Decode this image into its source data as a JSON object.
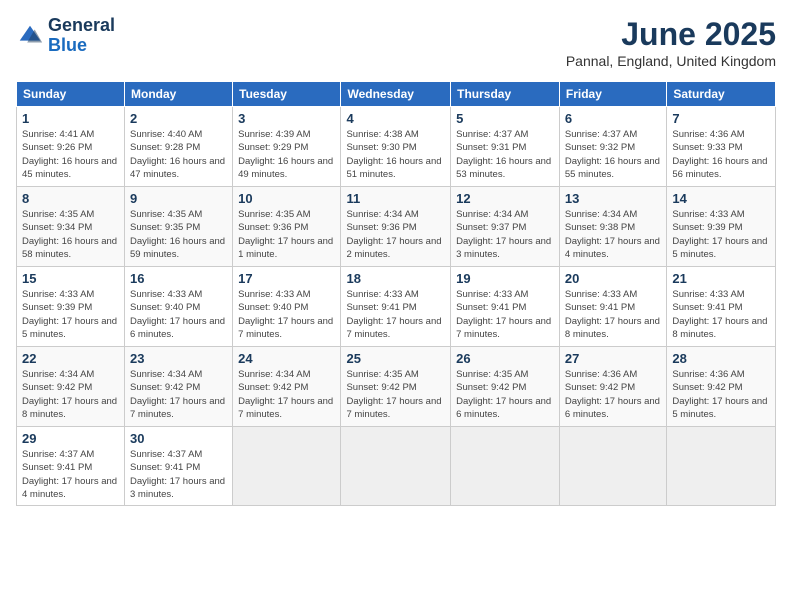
{
  "logo": {
    "line1": "General",
    "line2": "Blue"
  },
  "title": "June 2025",
  "subtitle": "Pannal, England, United Kingdom",
  "days_header": [
    "Sunday",
    "Monday",
    "Tuesday",
    "Wednesday",
    "Thursday",
    "Friday",
    "Saturday"
  ],
  "weeks": [
    [
      {
        "day": "1",
        "info": "Sunrise: 4:41 AM\nSunset: 9:26 PM\nDaylight: 16 hours and 45 minutes."
      },
      {
        "day": "2",
        "info": "Sunrise: 4:40 AM\nSunset: 9:28 PM\nDaylight: 16 hours and 47 minutes."
      },
      {
        "day": "3",
        "info": "Sunrise: 4:39 AM\nSunset: 9:29 PM\nDaylight: 16 hours and 49 minutes."
      },
      {
        "day": "4",
        "info": "Sunrise: 4:38 AM\nSunset: 9:30 PM\nDaylight: 16 hours and 51 minutes."
      },
      {
        "day": "5",
        "info": "Sunrise: 4:37 AM\nSunset: 9:31 PM\nDaylight: 16 hours and 53 minutes."
      },
      {
        "day": "6",
        "info": "Sunrise: 4:37 AM\nSunset: 9:32 PM\nDaylight: 16 hours and 55 minutes."
      },
      {
        "day": "7",
        "info": "Sunrise: 4:36 AM\nSunset: 9:33 PM\nDaylight: 16 hours and 56 minutes."
      }
    ],
    [
      {
        "day": "8",
        "info": "Sunrise: 4:35 AM\nSunset: 9:34 PM\nDaylight: 16 hours and 58 minutes."
      },
      {
        "day": "9",
        "info": "Sunrise: 4:35 AM\nSunset: 9:35 PM\nDaylight: 16 hours and 59 minutes."
      },
      {
        "day": "10",
        "info": "Sunrise: 4:35 AM\nSunset: 9:36 PM\nDaylight: 17 hours and 1 minute."
      },
      {
        "day": "11",
        "info": "Sunrise: 4:34 AM\nSunset: 9:36 PM\nDaylight: 17 hours and 2 minutes."
      },
      {
        "day": "12",
        "info": "Sunrise: 4:34 AM\nSunset: 9:37 PM\nDaylight: 17 hours and 3 minutes."
      },
      {
        "day": "13",
        "info": "Sunrise: 4:34 AM\nSunset: 9:38 PM\nDaylight: 17 hours and 4 minutes."
      },
      {
        "day": "14",
        "info": "Sunrise: 4:33 AM\nSunset: 9:39 PM\nDaylight: 17 hours and 5 minutes."
      }
    ],
    [
      {
        "day": "15",
        "info": "Sunrise: 4:33 AM\nSunset: 9:39 PM\nDaylight: 17 hours and 5 minutes."
      },
      {
        "day": "16",
        "info": "Sunrise: 4:33 AM\nSunset: 9:40 PM\nDaylight: 17 hours and 6 minutes."
      },
      {
        "day": "17",
        "info": "Sunrise: 4:33 AM\nSunset: 9:40 PM\nDaylight: 17 hours and 7 minutes."
      },
      {
        "day": "18",
        "info": "Sunrise: 4:33 AM\nSunset: 9:41 PM\nDaylight: 17 hours and 7 minutes."
      },
      {
        "day": "19",
        "info": "Sunrise: 4:33 AM\nSunset: 9:41 PM\nDaylight: 17 hours and 7 minutes."
      },
      {
        "day": "20",
        "info": "Sunrise: 4:33 AM\nSunset: 9:41 PM\nDaylight: 17 hours and 8 minutes."
      },
      {
        "day": "21",
        "info": "Sunrise: 4:33 AM\nSunset: 9:41 PM\nDaylight: 17 hours and 8 minutes."
      }
    ],
    [
      {
        "day": "22",
        "info": "Sunrise: 4:34 AM\nSunset: 9:42 PM\nDaylight: 17 hours and 8 minutes."
      },
      {
        "day": "23",
        "info": "Sunrise: 4:34 AM\nSunset: 9:42 PM\nDaylight: 17 hours and 7 minutes."
      },
      {
        "day": "24",
        "info": "Sunrise: 4:34 AM\nSunset: 9:42 PM\nDaylight: 17 hours and 7 minutes."
      },
      {
        "day": "25",
        "info": "Sunrise: 4:35 AM\nSunset: 9:42 PM\nDaylight: 17 hours and 7 minutes."
      },
      {
        "day": "26",
        "info": "Sunrise: 4:35 AM\nSunset: 9:42 PM\nDaylight: 17 hours and 6 minutes."
      },
      {
        "day": "27",
        "info": "Sunrise: 4:36 AM\nSunset: 9:42 PM\nDaylight: 17 hours and 6 minutes."
      },
      {
        "day": "28",
        "info": "Sunrise: 4:36 AM\nSunset: 9:42 PM\nDaylight: 17 hours and 5 minutes."
      }
    ],
    [
      {
        "day": "29",
        "info": "Sunrise: 4:37 AM\nSunset: 9:41 PM\nDaylight: 17 hours and 4 minutes."
      },
      {
        "day": "30",
        "info": "Sunrise: 4:37 AM\nSunset: 9:41 PM\nDaylight: 17 hours and 3 minutes."
      },
      {
        "day": "",
        "info": ""
      },
      {
        "day": "",
        "info": ""
      },
      {
        "day": "",
        "info": ""
      },
      {
        "day": "",
        "info": ""
      },
      {
        "day": "",
        "info": ""
      }
    ]
  ]
}
